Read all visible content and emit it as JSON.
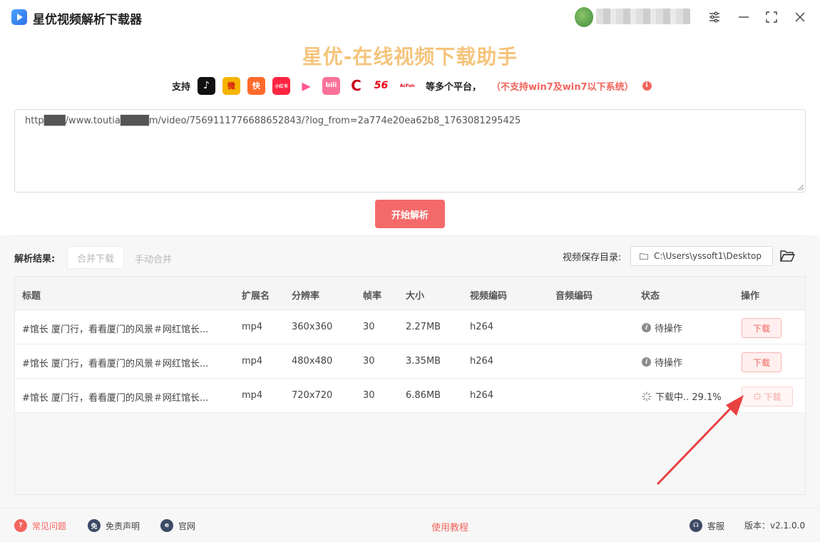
{
  "app": {
    "title": "星优视频解析下载器"
  },
  "header": {
    "headline": "星优-在线视频下载助手",
    "support_label": "支持",
    "support_suffix": "等多个平台，",
    "support_warning": "（不支持win7及win7以下系统）",
    "platforms": [
      {
        "name": "douyin-icon",
        "label": "♪",
        "color": "#111111"
      },
      {
        "name": "weibo-icon",
        "label": "微",
        "color": "#f5b400"
      },
      {
        "name": "kuaishou-icon",
        "label": "快",
        "color": "#ff6a2b"
      },
      {
        "name": "xiaohongshu-icon",
        "label": "小红书",
        "color": "#ff2442"
      },
      {
        "name": "tencent-video-icon",
        "label": "▶",
        "color": "#ffffff"
      },
      {
        "name": "bilibili-icon",
        "label": "bili",
        "color": "#fb7299"
      },
      {
        "name": "cctv-icon",
        "label": "C",
        "color": "#ffffff"
      },
      {
        "name": "56-icon",
        "label": "56",
        "color": "#ffffff"
      },
      {
        "name": "acfun-icon",
        "label": "AcFun",
        "color": "#ffffff"
      }
    ]
  },
  "input": {
    "url": "http███/www.toutia████m/video/7569111776688652843/?log_from=2a774e20ea62b8_1763081295425"
  },
  "actions": {
    "parse": "开始解析"
  },
  "results": {
    "label": "解析结果:",
    "merge_download": "合并下载",
    "manual_merge": "手动合并",
    "save_dir_label": "视频保存目录:",
    "save_dir": "C:\\Users\\yssoft1\\Desktop"
  },
  "table": {
    "headers": [
      "标题",
      "扩展名",
      "分辨率",
      "帧率",
      "大小",
      "视频编码",
      "音频编码",
      "状态",
      "操作"
    ],
    "rows": [
      {
        "title": "#馆长 厦门行，看看厦门的风景＃网红馆长...",
        "ext": "mp4",
        "res": "360x360",
        "fps": "30",
        "size": "2.27MB",
        "vcodec": "h264",
        "acodec": "",
        "status": "待操作",
        "action": "下载"
      },
      {
        "title": "#馆长 厦门行，看看厦门的风景＃网红馆长...",
        "ext": "mp4",
        "res": "480x480",
        "fps": "30",
        "size": "3.35MB",
        "vcodec": "h264",
        "acodec": "",
        "status": "待操作",
        "action": "下载"
      },
      {
        "title": "#馆长 厦门行，看看厦门的风景＃网红馆长...",
        "ext": "mp4",
        "res": "720x720",
        "fps": "30",
        "size": "6.86MB",
        "vcodec": "h264",
        "acodec": "",
        "status": "下载中.. 29.1%",
        "action": "下载"
      }
    ]
  },
  "footer": {
    "faq": "常见问题",
    "disclaimer": "免责声明",
    "website": "官网",
    "tutorial": "使用教程",
    "support": "客服",
    "version": "版本：v2.1.0.0"
  },
  "colors": {
    "accent": "#f46a6a",
    "headline": "#f5c47c"
  }
}
